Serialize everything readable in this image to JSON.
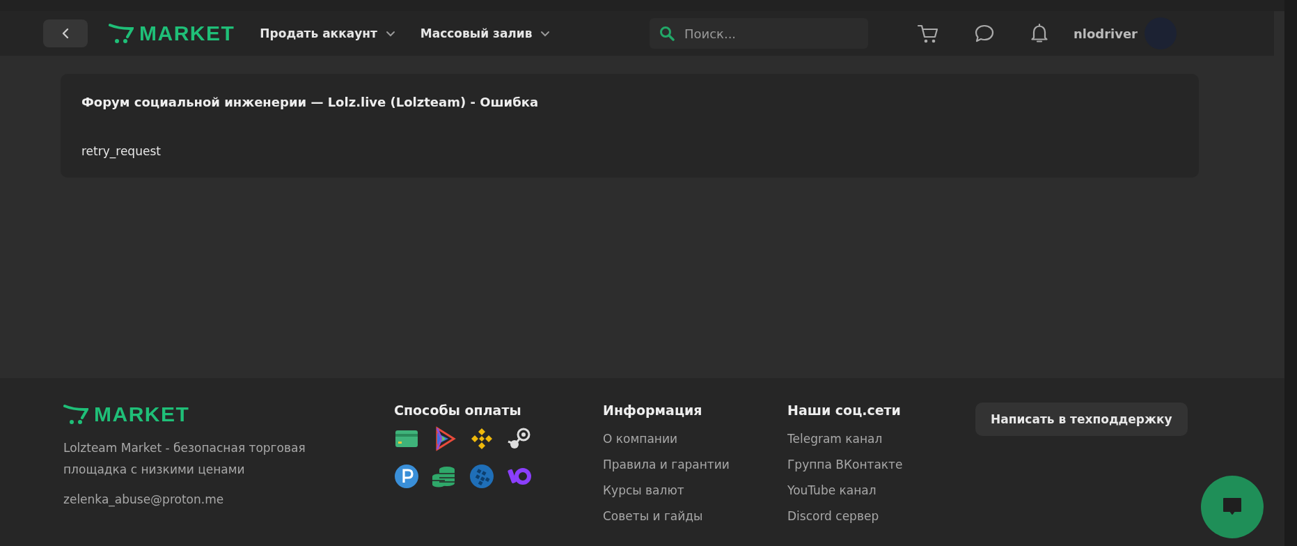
{
  "header": {
    "nav": [
      {
        "label": "Продать аккаунт"
      },
      {
        "label": "Массовый залив"
      }
    ],
    "logo": "MARKET",
    "search": {
      "placeholder": "Поиск..."
    },
    "username": "nlodriver"
  },
  "error_card": {
    "title": "Форум социальной инженерии — Lolz.live (Lolzteam) - Ошибка",
    "message": "retry_request"
  },
  "footer": {
    "logo": "MARKET",
    "description": "Lolzteam Market - безопасная торговая площадка с низкими ценами",
    "email": "zelenka_abuse@proton.me",
    "payments_title": "Способы оплаты",
    "info_title": "Информация",
    "info_links": [
      "О компании",
      "Правила и гарантии",
      "Курсы валют",
      "Советы и гайды"
    ],
    "social_title": "Наши соц.сети",
    "social_links": [
      "Telegram канал",
      "Группа ВКонтакте",
      "YouTube канал",
      "Discord сервер"
    ],
    "support_button": "Написать в техподдержку"
  }
}
